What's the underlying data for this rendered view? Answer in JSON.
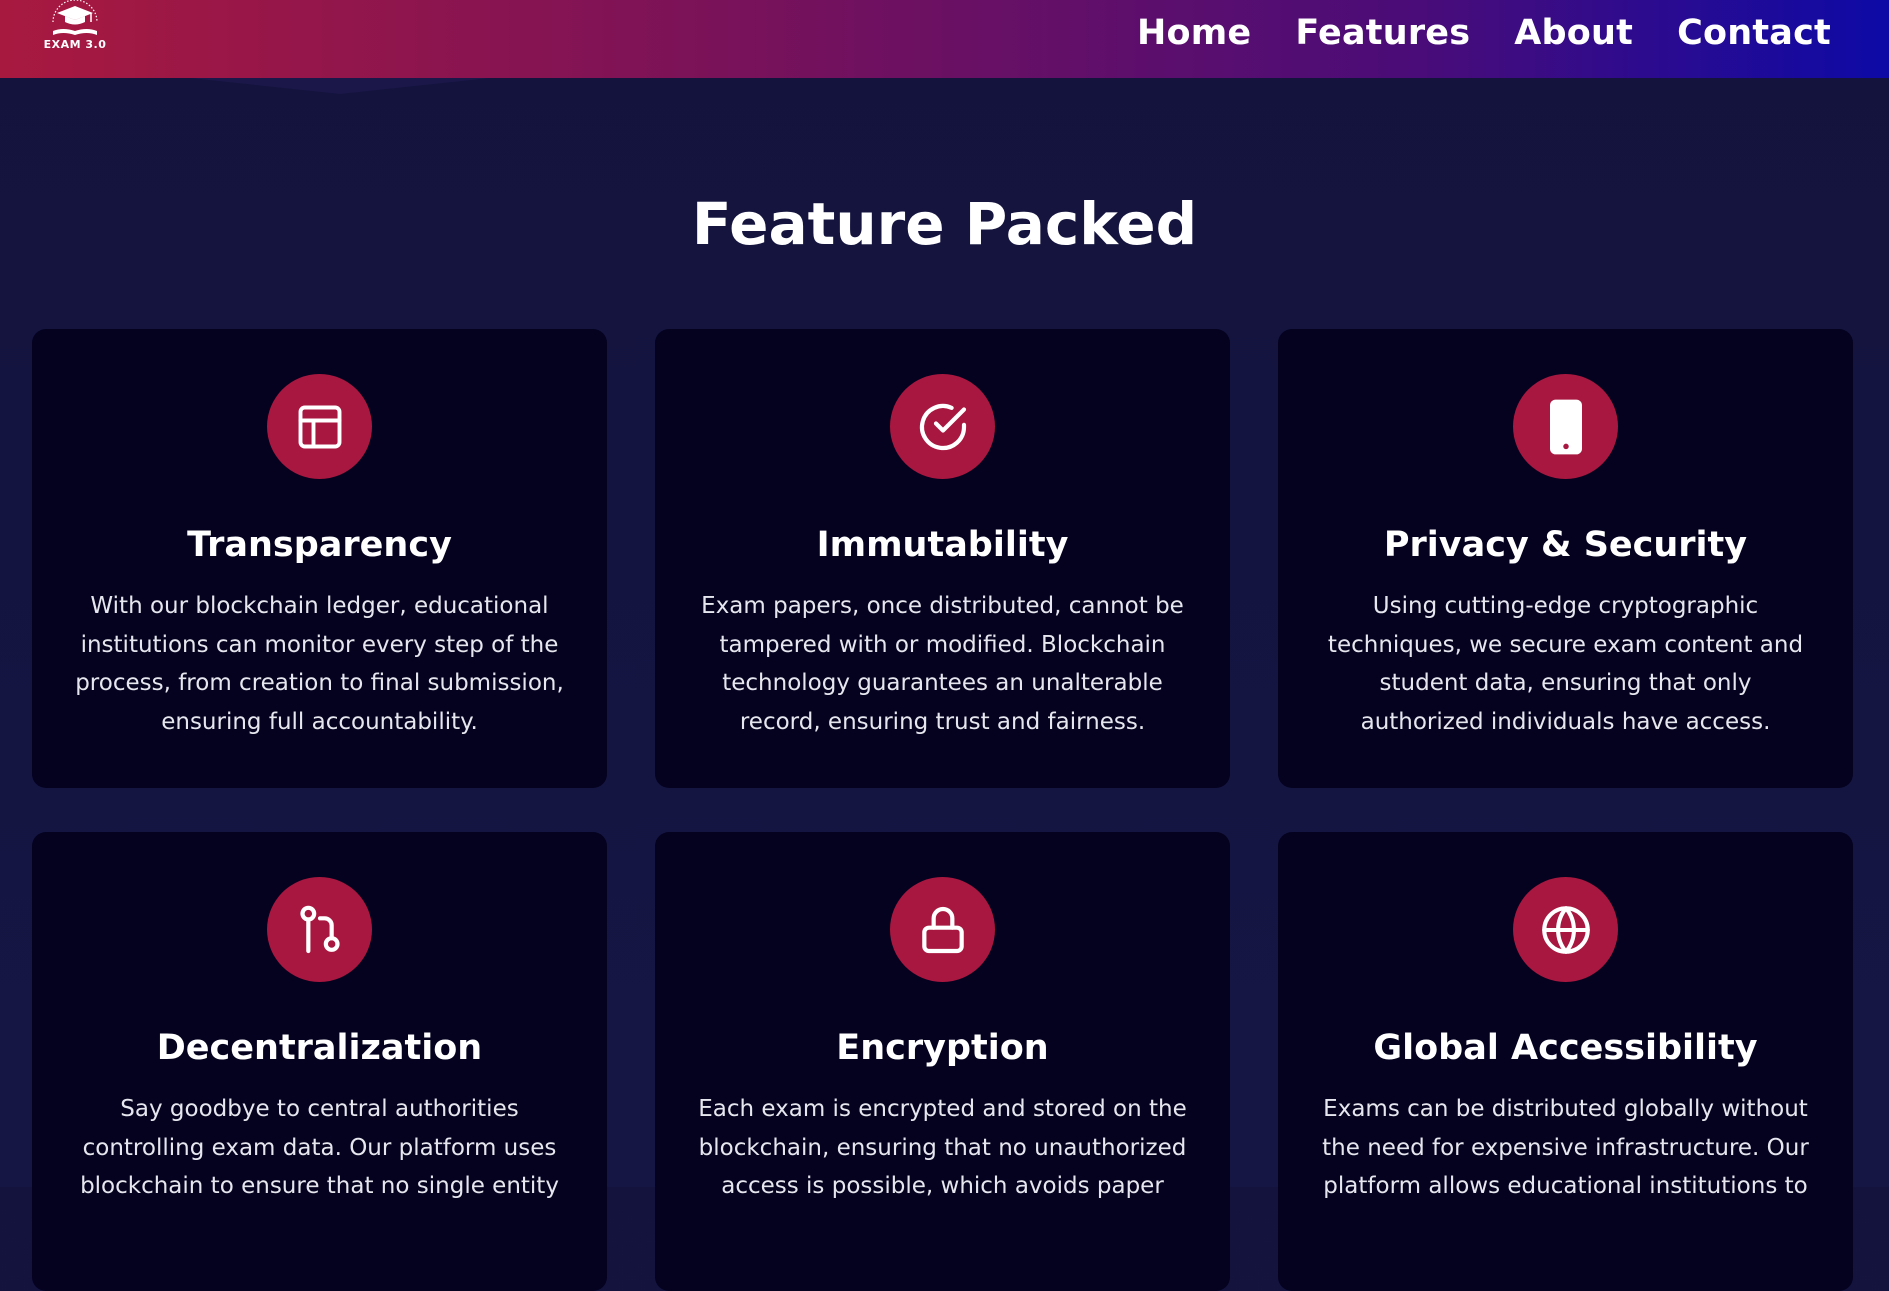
{
  "brand": {
    "logo_text": "EXAM 3.0",
    "logo_arc_text": "DECENTRALIZED EXAMS"
  },
  "nav": {
    "links": [
      "Home",
      "Features",
      "About",
      "Contact"
    ]
  },
  "features": {
    "title": "Feature Packed",
    "cards": [
      {
        "icon": "layout-icon",
        "title": "Transparency",
        "description": "With our blockchain ledger, educational institutions can monitor every step of the process, from creation to final submission, ensuring full accountability."
      },
      {
        "icon": "check-circle-icon",
        "title": "Immutability",
        "description": "Exam papers, once distributed, cannot be tampered with or modified. Blockchain technology guarantees an unalterable record, ensuring trust and fairness."
      },
      {
        "icon": "phone-icon",
        "title": "Privacy & Security",
        "description": "Using cutting-edge cryptographic techniques, we secure exam content and student data, ensuring that only authorized individuals have access."
      },
      {
        "icon": "git-pull-request-icon",
        "title": "Decentralization",
        "description": "Say goodbye to central authorities controlling exam data. Our platform uses blockchain to ensure that no single entity"
      },
      {
        "icon": "lock-icon",
        "title": "Encryption",
        "description": "Each exam is encrypted and stored on the blockchain, ensuring that no unauthorized access is possible, which avoids paper"
      },
      {
        "icon": "globe-icon",
        "title": "Global Accessibility",
        "description": "Exams can be distributed globally without the need for expensive infrastructure. Our platform allows educational institutions to"
      }
    ]
  },
  "colors": {
    "accent": "#a8173f",
    "background": "#13133d",
    "card": "#04021f",
    "nav_gradient_start": "#a8193f",
    "nav_gradient_end": "#0d0aa6"
  }
}
